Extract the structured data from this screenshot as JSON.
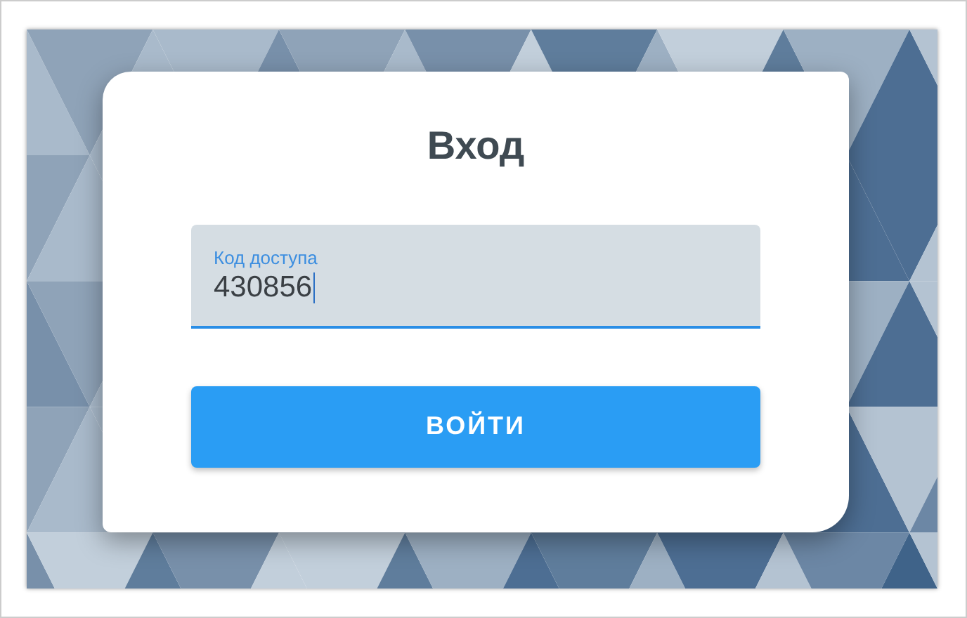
{
  "login": {
    "title": "Вход",
    "field": {
      "label": "Код доступа",
      "value": "430856",
      "focused": true
    },
    "button": "ВОЙТИ"
  }
}
